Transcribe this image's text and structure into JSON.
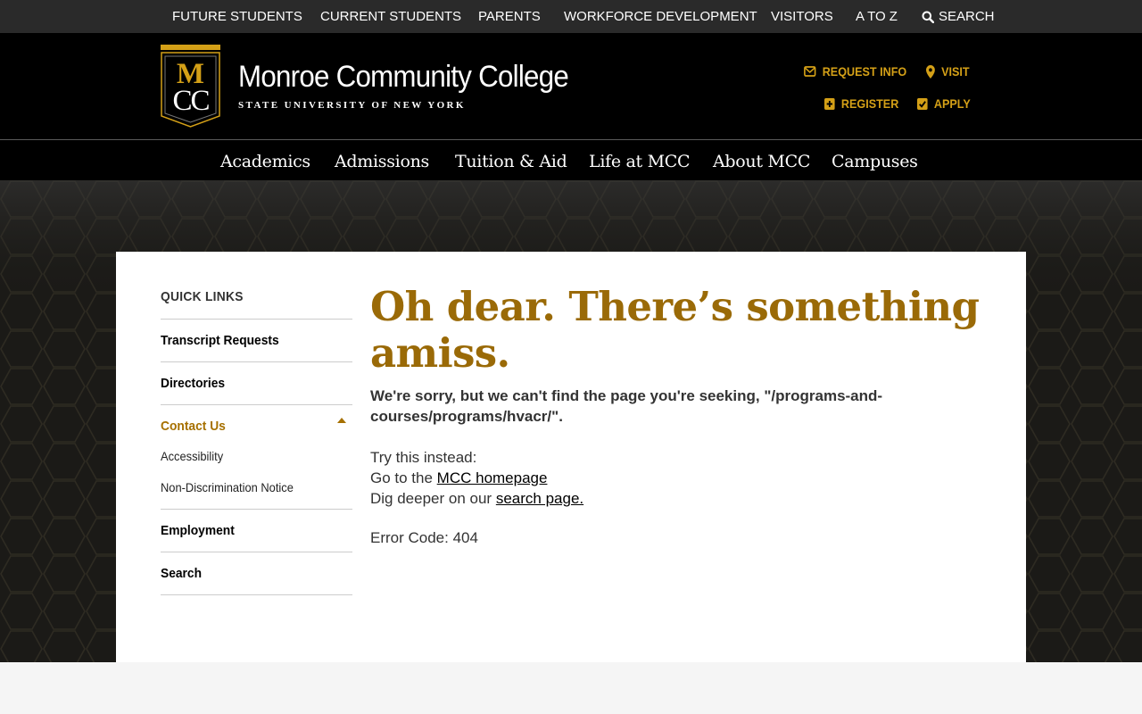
{
  "utility_nav": {
    "items": [
      "FUTURE STUDENTS",
      "CURRENT STUDENTS",
      "PARENTS",
      "WORKFORCE DEVELOPMENT",
      "VISITORS",
      "A TO Z"
    ],
    "search_label": "SEARCH"
  },
  "header": {
    "logo_letters": "MCC",
    "brand_name": "Monroe Community College",
    "brand_sub": "STATE UNIVERSITY OF NEW YORK",
    "links": {
      "request_info": "REQUEST INFO",
      "visit": "VISIT",
      "register": "REGISTER",
      "apply": "APPLY"
    }
  },
  "main_nav": [
    "Academics",
    "Admissions",
    "Tuition & Aid",
    "Life at MCC",
    "About MCC",
    "Campuses"
  ],
  "sidebar": {
    "heading": "QUICK LINKS",
    "items": [
      "Transcript Requests",
      "Directories",
      "Contact Us",
      "Employment",
      "Search"
    ],
    "contact_sub": [
      "Accessibility",
      "Non-Discrimination Notice"
    ]
  },
  "content": {
    "title": "Oh dear. There’s something amiss.",
    "lead": "We're sorry, but we can't find the page you're seeking, \"/programs-and-courses/programs/hvacr/\".",
    "try_this": "Try this instead:",
    "goto_prefix": "Go to the ",
    "homepage_link": "MCC homepage",
    "dig_prefix": "Dig deeper on our ",
    "search_link": "search page.",
    "error_code": "Error Code: 404"
  },
  "colors": {
    "gold": "#d4a017",
    "title_gold": "#9a6a07",
    "active_link": "#a67000",
    "header_bg": "#000000",
    "utility_bg": "#2a2a2a"
  }
}
